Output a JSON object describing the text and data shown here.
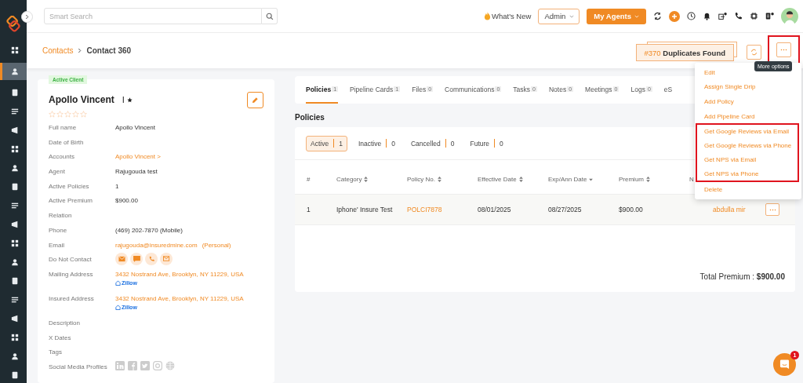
{
  "sidebar": {
    "items": [
      {
        "selected": false
      },
      {
        "selected": true
      },
      {
        "selected": false
      },
      {
        "selected": false
      },
      {
        "selected": false
      },
      {
        "selected": false
      },
      {
        "selected": false
      },
      {
        "selected": false
      },
      {
        "selected": false
      },
      {
        "selected": false
      },
      {
        "selected": false
      },
      {
        "selected": false
      },
      {
        "selected": false
      },
      {
        "selected": false
      },
      {
        "selected": false
      },
      {
        "selected": false
      },
      {
        "selected": false
      },
      {
        "selected": false
      }
    ]
  },
  "header": {
    "search": {
      "placeholder": "Smart Search"
    },
    "whats_new": "What's New",
    "role_select": "Admin",
    "agents_button": "My Agents"
  },
  "breadcrumb": {
    "parent": "Contacts",
    "current": "Contact 360"
  },
  "duplicates": {
    "count": "#370",
    "label": "Duplicates Found"
  },
  "more_button": {
    "highlighted": true,
    "tooltip": "More options"
  },
  "menu": {
    "items": [
      {
        "label": "Edit",
        "highlighted": false
      },
      {
        "label": "Assign Single Drip",
        "highlighted": false
      },
      {
        "label": "Add Policy",
        "highlighted": false
      },
      {
        "label": "Add Pipeline Card",
        "highlighted": false
      },
      {
        "label": "Get Google Reviews via Email",
        "highlighted": true
      },
      {
        "label": "Get Google Reviews via Phone",
        "highlighted": true
      },
      {
        "label": "Get NPS via Email",
        "highlighted": true
      },
      {
        "label": "Get NPS via Phone",
        "highlighted": true
      },
      {
        "label": "Delete",
        "highlighted": false
      }
    ]
  },
  "contact": {
    "status": "Active Client",
    "name": "Apollo Vincent",
    "initial": "I",
    "stars": 0,
    "fields": [
      {
        "label": "Full name",
        "kind": "text",
        "value": "Apollo Vincent"
      },
      {
        "label": "Date of Birth",
        "kind": "text"
      },
      {
        "label": "Accounts",
        "kind": "link",
        "value": "Apollo Vincent >"
      },
      {
        "label": "Agent",
        "kind": "text",
        "value": "Rajugouda test"
      },
      {
        "label": "Active Policies",
        "kind": "text",
        "value": "1"
      },
      {
        "label": "Active Premium",
        "kind": "text",
        "value": "$900.00"
      },
      {
        "label": "Relation",
        "kind": "text"
      },
      {
        "label": "Phone",
        "kind": "text",
        "value": "(469) 202-7870 (Mobile)"
      },
      {
        "label": "Email",
        "kind": "email",
        "value": "rajugouda@insuredmine.com",
        "note": "(Personal)"
      },
      {
        "label": "Do Not Contact",
        "kind": "contact_icons"
      },
      {
        "label": "Mailing Address",
        "kind": "address",
        "value": "3432 Nostrand Ave, Brooklyn, NY 11229, USA",
        "link": "Zillow"
      },
      {
        "label": "Insured Address",
        "kind": "address",
        "value": "3432 Nostrand Ave, Brooklyn, NY 11229, USA",
        "link": "Zillow"
      },
      {
        "label": "Description",
        "kind": "text"
      },
      {
        "label": "X Dates",
        "kind": "text"
      },
      {
        "label": "Tags",
        "kind": "text"
      },
      {
        "label": "Social Media Profiles",
        "kind": "social"
      }
    ]
  },
  "tabs": [
    {
      "label": "Policies",
      "count": "1",
      "selected": true
    },
    {
      "label": "Pipeline Cards",
      "count": "1",
      "selected": false
    },
    {
      "label": "Files",
      "count": "0",
      "selected": false
    },
    {
      "label": "Communications",
      "count": "0",
      "selected": false
    },
    {
      "label": "Tasks",
      "count": "0",
      "selected": false
    },
    {
      "label": "Notes",
      "count": "0",
      "selected": false
    },
    {
      "label": "Meetings",
      "count": "0",
      "selected": false
    },
    {
      "label": "Logs",
      "count": "0",
      "selected": false
    },
    {
      "label": "eS",
      "selected": false
    }
  ],
  "policies": {
    "title": "Policies",
    "filters": [
      {
        "label": "Active",
        "count": "1",
        "selected": true
      },
      {
        "label": "Inactive",
        "count": "0",
        "selected": false
      },
      {
        "label": "Cancelled",
        "count": "0",
        "selected": false
      },
      {
        "label": "Future",
        "count": "0",
        "selected": false
      }
    ],
    "columns": [
      {
        "label": "#",
        "sortable": false
      },
      {
        "label": "Category",
        "sortable": true,
        "sorted": false
      },
      {
        "label": "Policy No.",
        "sortable": true,
        "sorted": false
      },
      {
        "label": "Effective Date",
        "sortable": true,
        "sorted": false
      },
      {
        "label": "Exp/Ann Date",
        "sorted": true
      },
      {
        "label": "Premium",
        "sortable": true,
        "sorted": false
      },
      {
        "label": "N"
      }
    ],
    "rows": [
      {
        "number": "1",
        "category": "Iphone' Insure Test",
        "policy_no": "POLCI7878",
        "effective_date": "08/01/2025",
        "exp_date": "08/27/2025",
        "premium": "$900.00",
        "agent": "abdulla mir"
      }
    ],
    "total": "Total Premium : **$900.00**"
  },
  "chat": {
    "badge": "1"
  }
}
